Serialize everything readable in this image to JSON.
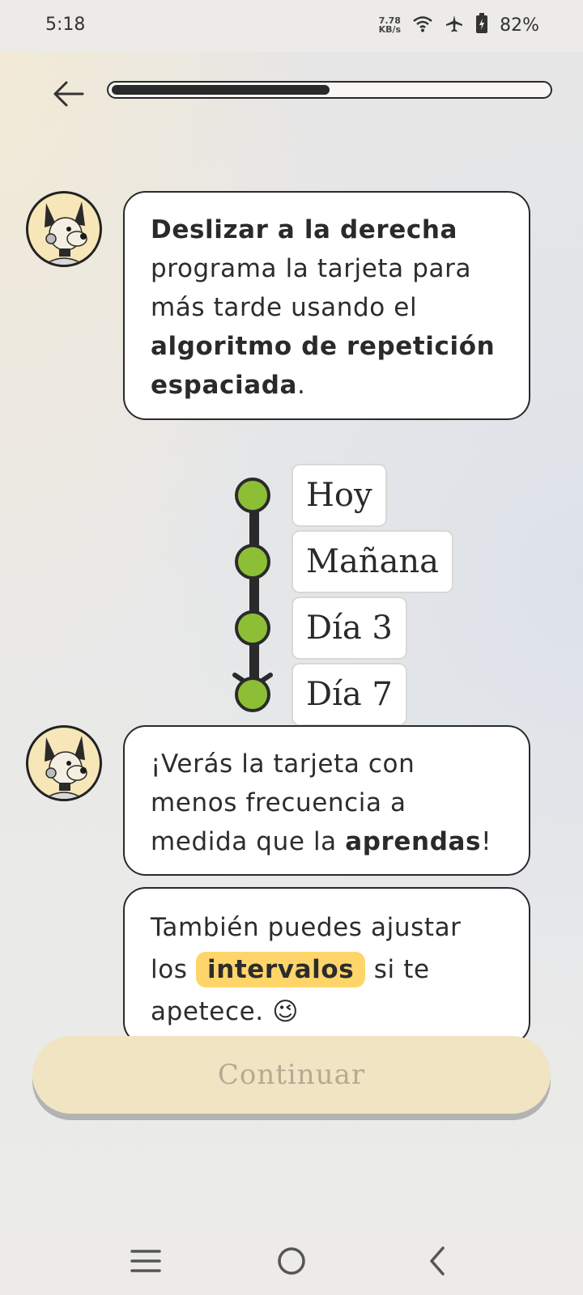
{
  "status": {
    "time": "5:18",
    "speed_value": "7.78",
    "speed_unit": "KB/s",
    "battery": "82%"
  },
  "progress": {
    "value": 0.5
  },
  "messages": [
    {
      "parts": [
        {
          "text": "Deslizar a la derecha",
          "bold": true
        },
        {
          "text": " programa la tarjeta para más tarde usando el ",
          "bold": false
        },
        {
          "text": "algoritmo de repetición espaciada",
          "bold": true
        },
        {
          "text": ".",
          "bold": false
        }
      ]
    },
    {
      "parts": [
        {
          "text": "¡Verás la tarjeta con menos frecuencia a medida que la ",
          "bold": false
        },
        {
          "text": "aprendas",
          "bold": true
        },
        {
          "text": "!",
          "bold": false
        }
      ]
    },
    {
      "parts": [
        {
          "text": "También puedes ajustar los ",
          "bold": false
        },
        {
          "text": "intervalos",
          "chip": true
        },
        {
          "text": " si te apetece. ",
          "bold": false
        },
        {
          "text": "😉",
          "emoji": true
        }
      ]
    }
  ],
  "timeline": [
    "Hoy",
    "Mañana",
    "Día 3",
    "Día 7"
  ],
  "continue_label": "Continuar",
  "colors": {
    "dot": "#8cbf36",
    "chip": "#ffd56a",
    "button": "#f1e4c2"
  }
}
